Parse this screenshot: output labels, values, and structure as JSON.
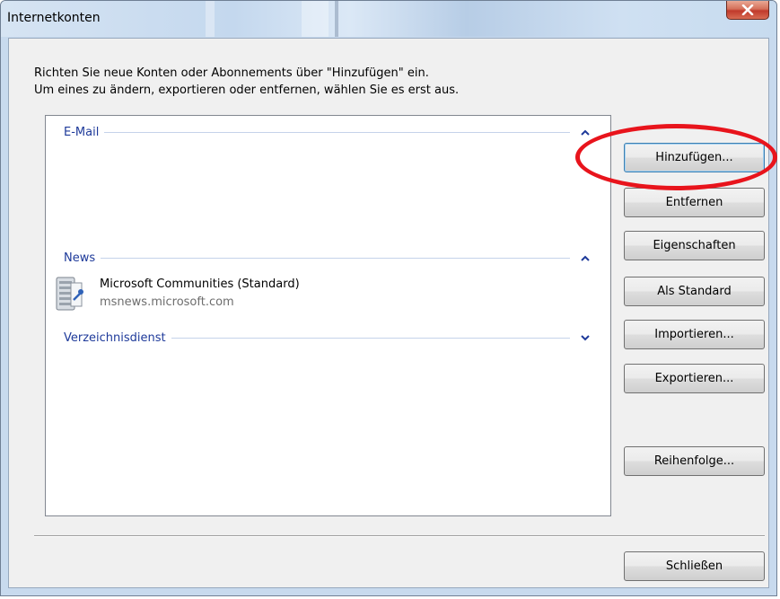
{
  "window": {
    "title": "Internetkonten"
  },
  "intro": {
    "line1": "Richten Sie neue Konten oder Abonnements über \"Hinzufügen\" ein.",
    "line2": "Um eines zu ändern, exportieren oder entfernen, wählen Sie es erst aus."
  },
  "groups": [
    {
      "name": "E-Mail",
      "chevron": "chevron-up-icon"
    },
    {
      "name": "News",
      "chevron": "chevron-up-icon"
    },
    {
      "name": "Verzeichnisdienst",
      "chevron": "chevron-down-icon"
    }
  ],
  "accounts": [
    {
      "name": "Microsoft Communities (Standard)",
      "server": "msnews.microsoft.com",
      "icon": "news-server-icon"
    }
  ],
  "buttons": {
    "add": "Hinzufügen...",
    "remove": "Entfernen",
    "properties": "Eigenschaften",
    "set_default": "Als Standard",
    "import": "Importieren...",
    "export": "Exportieren...",
    "order": "Reihenfolge...",
    "close": "Schließen"
  },
  "colors": {
    "group_header_text": "#1e3a9a",
    "annotation_ring": "#e8141c",
    "close_button": "#c0392b"
  }
}
